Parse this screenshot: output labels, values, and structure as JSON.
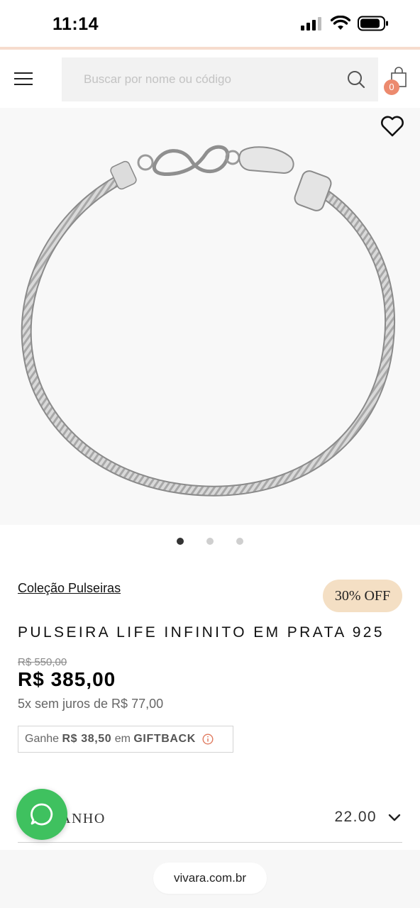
{
  "status_bar": {
    "time": "11:14",
    "icons": [
      "cellular-signal-icon",
      "wifi-icon",
      "battery-icon"
    ]
  },
  "header": {
    "menu_icon": "hamburger-menu-icon",
    "search": {
      "placeholder": "Buscar por nome ou código",
      "value": ""
    },
    "search_icon": "search-icon",
    "cart": {
      "icon": "shopping-bag-icon",
      "count": "0"
    }
  },
  "product_image": {
    "wishlist_icon": "heart-icon",
    "gallery_total": 3,
    "gallery_active": 1
  },
  "product": {
    "collection": "Coleção Pulseiras",
    "discount_badge": "30% OFF",
    "title": "PULSEIRA LIFE INFINITO EM PRATA 925",
    "old_price": "R$ 550,00",
    "price": "R$ 385,00",
    "installments": "5x sem juros de R$ 77,00",
    "giftback": {
      "prefix": "Ganhe",
      "amount": "R$ 38,50",
      "middle": "em",
      "label": "GIFTBACK",
      "info_icon": "info-icon"
    }
  },
  "size": {
    "label": "ANHO",
    "value": "22.00",
    "icon": "chevron-down-icon"
  },
  "whatsapp": {
    "icon": "whatsapp-icon"
  },
  "browser": {
    "url": "vivara.com.br"
  },
  "colors": {
    "accent_line": "#f6dccd",
    "cart_badge": "#ec8a6e",
    "discount_badge": "#f4dfc4",
    "whatsapp": "#3fc15f"
  }
}
